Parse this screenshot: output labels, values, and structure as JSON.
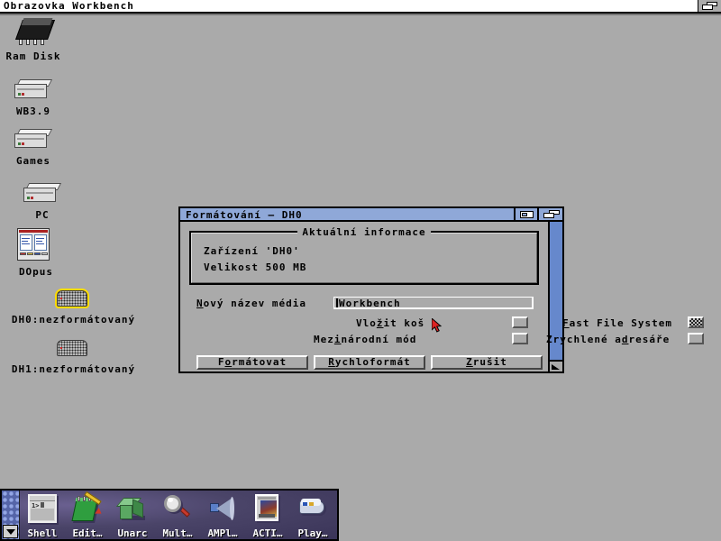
{
  "screen": {
    "title": "Obrazovka Workbench",
    "depth_gadget_icon": "depth-arrange-icon"
  },
  "desktop": {
    "icons": [
      {
        "label": "Ram Disk",
        "icon": "ram-chip-icon",
        "selected": false
      },
      {
        "label": "WB3.9",
        "icon": "hard-drive-icon",
        "selected": false
      },
      {
        "label": "Games",
        "icon": "hard-drive-icon",
        "selected": false
      },
      {
        "label": "PC",
        "icon": "hard-drive-icon",
        "selected": false
      },
      {
        "label": "DOpus",
        "icon": "directory-opus-icon",
        "selected": false
      },
      {
        "label": "DH0:nezformátovaný",
        "icon": "unformatted-disk-icon",
        "selected": true
      },
      {
        "label": "DH1:nezformátovaný",
        "icon": "unformatted-disk-icon",
        "selected": false
      }
    ]
  },
  "format_window": {
    "title": "Formátování – DH0",
    "zoom_gadget_icon": "window-zoom-icon",
    "depth_gadget_icon": "window-depth-icon",
    "resize_gadget_icon": "window-resize-icon",
    "info_group": {
      "title": "Aktuální informace",
      "lines": [
        "Zařízení 'DH0'",
        "Velikost 500 MB"
      ]
    },
    "name_field": {
      "label": "Nový název média",
      "label_key": "N",
      "value": "Workbench"
    },
    "checkboxes": [
      {
        "label": "Vložit koš",
        "key": "t",
        "checked": false
      },
      {
        "label": "Mezinárodní mód",
        "key": "i",
        "checked": false
      },
      {
        "label": "Fast File System",
        "key": "F",
        "checked": true
      },
      {
        "label": "Zrychlené adresáře",
        "key": "d",
        "checked": false
      }
    ],
    "buttons": [
      {
        "label": "Formátovat",
        "key": "o"
      },
      {
        "label": "Rychloformát",
        "key": "R"
      },
      {
        "label": "Zrušit",
        "key": "Z"
      }
    ]
  },
  "dock": {
    "handle_arrow_icon": "chevron-down-icon",
    "items": [
      {
        "label": "Shell",
        "icon": "shell-window-icon"
      },
      {
        "label": "Edit…",
        "icon": "notepad-pencil-icon"
      },
      {
        "label": "Unarc",
        "icon": "green-cube-icon"
      },
      {
        "label": "Mult…",
        "icon": "magnifier-icon"
      },
      {
        "label": "AMPl…",
        "icon": "speaker-icon"
      },
      {
        "label": "ACTI…",
        "icon": "picture-viewer-icon"
      },
      {
        "label": "Play…",
        "icon": "media-player-icon"
      }
    ]
  },
  "pointer": {
    "icon": "mouse-pointer-icon"
  },
  "colors": {
    "desktop_gray": "#aaaaaa",
    "title_blue": "#8fa8d8",
    "border_blue": "#6688cc",
    "selection_yellow": "#ffdd00",
    "dock_purple": "#4b4668"
  }
}
